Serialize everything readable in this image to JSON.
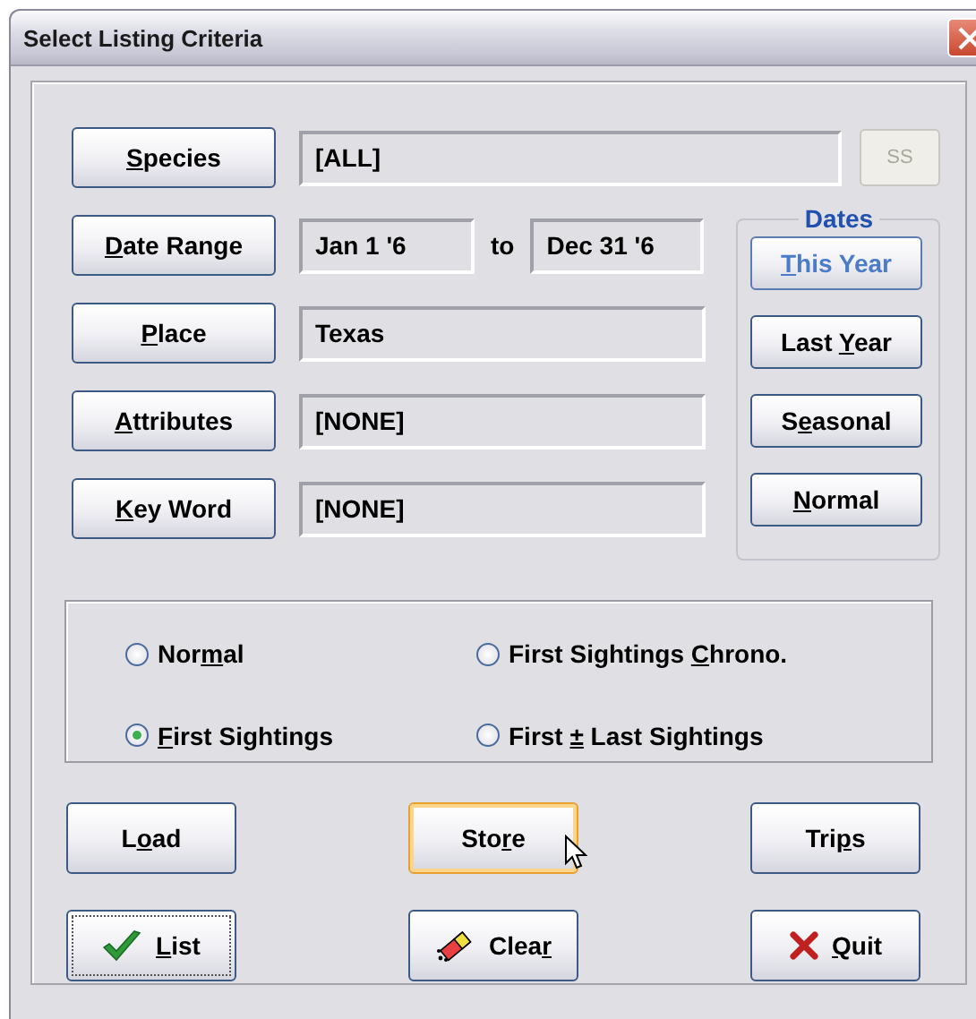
{
  "window": {
    "title": "Select Listing Criteria"
  },
  "criteria": [
    {
      "kind": "single",
      "button": {
        "key": "S",
        "post": "pecies"
      },
      "value": "[ALL]",
      "extra": {
        "label": "SS",
        "disabled": true
      }
    },
    {
      "kind": "range",
      "button": {
        "key": "D",
        "post": "ate Range"
      },
      "from": "Jan 1 '6",
      "to_label": "to",
      "to": "Dec 31 '6"
    },
    {
      "kind": "single",
      "button": {
        "key": "P",
        "post": "lace"
      },
      "value": "Texas"
    },
    {
      "kind": "single",
      "button": {
        "key": "A",
        "post": "ttributes"
      },
      "value": "[NONE]"
    },
    {
      "kind": "single",
      "button": {
        "key": "K",
        "post": "ey Word"
      },
      "value": "[NONE]"
    }
  ],
  "dates": {
    "title": "Dates",
    "buttons": [
      {
        "key": "T",
        "post": "his Year",
        "selected": true
      },
      {
        "pre": "Last ",
        "key": "Y",
        "post": "ear",
        "selected": false
      },
      {
        "pre": "S",
        "key": "e",
        "post": "asonal",
        "selected": false
      },
      {
        "key": "N",
        "post": "ormal",
        "selected": false
      }
    ]
  },
  "modes": [
    {
      "pre": "Nor",
      "key": "m",
      "post": "al",
      "selected": false
    },
    {
      "pre": "First Sightings ",
      "key": "C",
      "post": "hrono.",
      "selected": false
    },
    {
      "key": "F",
      "post": "irst Sightings",
      "selected": true
    },
    {
      "pre": "First ",
      "key": "±",
      "post": " Last Sightings",
      "selected": false
    }
  ],
  "actions": [
    {
      "kind": "plain",
      "pre": "L",
      "key": "o",
      "post": "ad",
      "hovered": false,
      "focused": false
    },
    {
      "kind": "plain",
      "pre": "Sto",
      "key": "r",
      "post": "e",
      "hovered": true,
      "focused": false
    },
    {
      "kind": "plain",
      "pre": "Tri",
      "key": "p",
      "post": "s",
      "hovered": false,
      "focused": false
    },
    {
      "kind": "check",
      "key": "L",
      "post": "ist",
      "hovered": false,
      "focused": true
    },
    {
      "kind": "eraser",
      "pre": "Clea",
      "key": "r",
      "hovered": false,
      "focused": false
    },
    {
      "kind": "cross",
      "key": "Q",
      "post": "uit",
      "hovered": false,
      "focused": false
    }
  ]
}
